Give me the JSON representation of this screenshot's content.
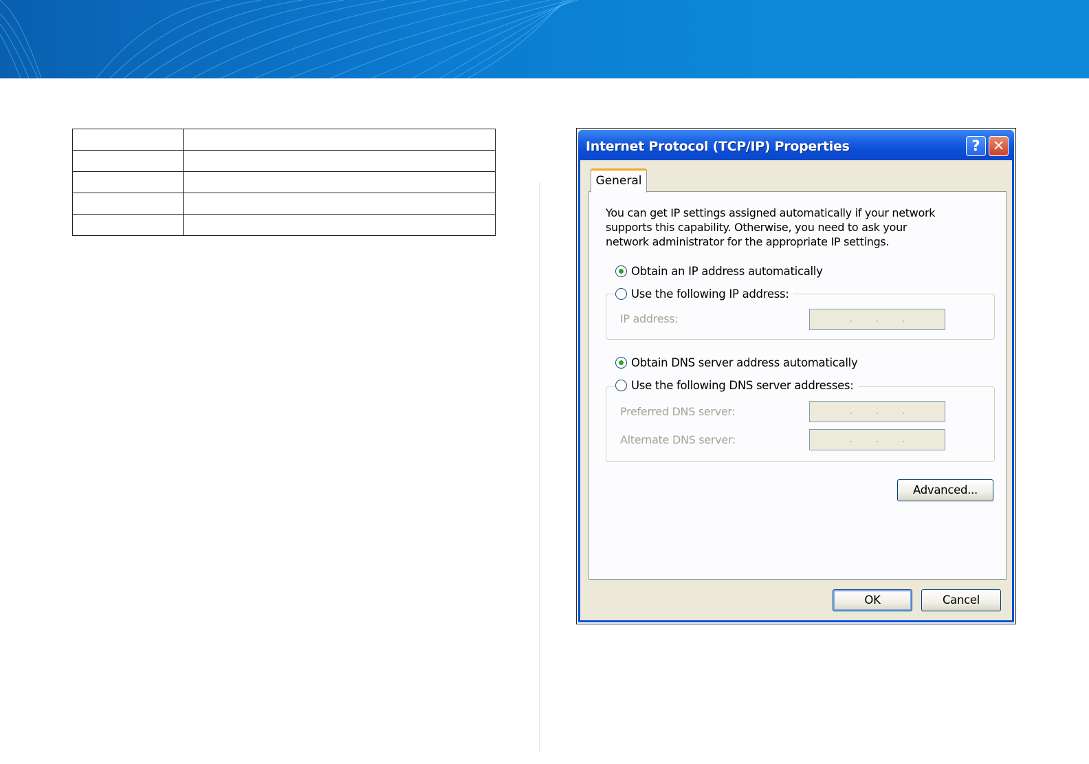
{
  "dialog": {
    "title": "Internet Protocol (TCP/IP) Properties",
    "help_label": "?",
    "close_label": "✕",
    "tab_general": "General",
    "intro_text": "You can get IP settings assigned automatically if your network supports this capability. Otherwise, you need to ask your network administrator for the appropriate IP settings.",
    "obtain_ip_label": "Obtain an IP address automatically",
    "use_ip_label": "Use the following IP address:",
    "ip_address_label": "IP address:",
    "obtain_dns_label": "Obtain DNS server address automatically",
    "use_dns_label": "Use the following DNS server addresses:",
    "preferred_dns_label": "Preferred DNS server:",
    "alternate_dns_label": "Alternate DNS server:",
    "ip_separator": ".",
    "advanced_label": "Advanced...",
    "ok_label": "OK",
    "cancel_label": "Cancel",
    "selected_ip_mode": "obtain-automatically",
    "selected_dns_mode": "obtain-automatically"
  },
  "colors": {
    "banner": "#0c7bd0",
    "titlebar": "#0a4dd6",
    "dialog_bg": "#ece9d8",
    "tab_accent": "#f4a52a",
    "radio_selected": "#2aa52a"
  }
}
